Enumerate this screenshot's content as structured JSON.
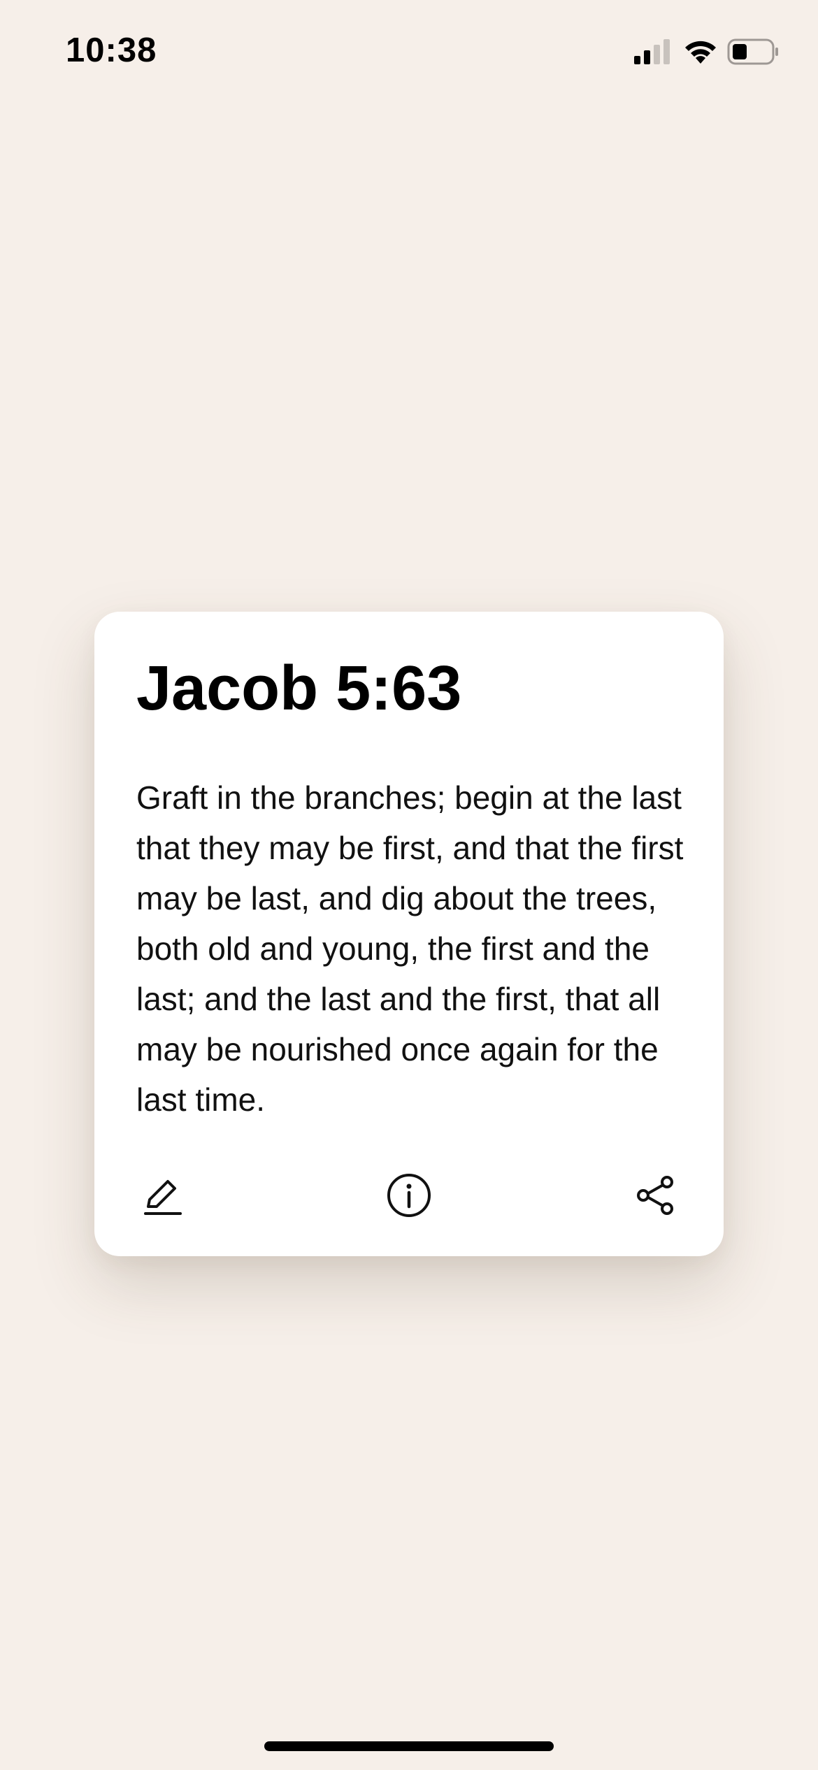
{
  "status_bar": {
    "time": "10:38",
    "signal_icon": "cellular-signal-icon",
    "wifi_icon": "wifi-icon",
    "battery_icon": "battery-icon",
    "battery_level": 0.35
  },
  "card": {
    "reference": "Jacob 5:63",
    "text": "Graft in the branches; begin at the last that they may be first, and that the first may be last, and dig about the trees, both old and young, the first and the last; and the last and the first, that all may be nourished once again for the last time.",
    "actions": {
      "edit_icon": "pencil-icon",
      "info_icon": "info-icon",
      "share_icon": "share-icon"
    }
  },
  "colors": {
    "background": "#f6efe9",
    "card": "#ffffff",
    "text": "#111111"
  }
}
